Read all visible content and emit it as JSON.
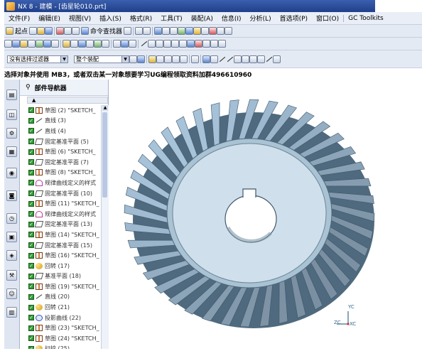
{
  "title_bar": {
    "text": "NX 8 - 建模 - [齿星轮010.prt]"
  },
  "menu": [
    {
      "label": "文件(F)"
    },
    {
      "label": "编辑(E)"
    },
    {
      "label": "视图(V)"
    },
    {
      "label": "插入(S)"
    },
    {
      "label": "格式(R)"
    },
    {
      "label": "工具(T)"
    },
    {
      "label": "装配(A)"
    },
    {
      "label": "信息(I)"
    },
    {
      "label": "分析(L)"
    },
    {
      "label": "首选项(P)"
    },
    {
      "label": "窗口(O)"
    },
    {
      "label": "GC Toolkits"
    }
  ],
  "toolbar1": {
    "start_label": "起点",
    "command_finder_label": "命令查找器"
  },
  "toolbar3": {
    "filter_value": "没有选择过滤器",
    "scope_value": "整个装配"
  },
  "status": {
    "text": "选择对象并使用 MB3，或者双击某一对象想要学习UG编程领取资料加群496610960"
  },
  "navigator": {
    "title": "部件导航器",
    "items": [
      {
        "icon": "sketch",
        "label": "草图 (2) \"SKETCH_"
      },
      {
        "icon": "line",
        "label": "直线 (3)"
      },
      {
        "icon": "line",
        "label": "直线 (4)"
      },
      {
        "icon": "plane",
        "label": "固定基准平面 (5)"
      },
      {
        "icon": "sketch",
        "label": "草图 (6) \"SKETCH_"
      },
      {
        "icon": "plane",
        "label": "固定基准平面 (7)"
      },
      {
        "icon": "sketch",
        "label": "草图 (8) \"SKETCH_"
      },
      {
        "icon": "curve",
        "label": "规律曲线定义的样式"
      },
      {
        "icon": "plane",
        "label": "固定基准平面 (10)"
      },
      {
        "icon": "sketch",
        "label": "草图 (11) \"SKETCH_"
      },
      {
        "icon": "curve",
        "label": "规律曲线定义的样式"
      },
      {
        "icon": "plane",
        "label": "固定基准平面 (13)"
      },
      {
        "icon": "sketch",
        "label": "草图 (14) \"SKETCH_"
      },
      {
        "icon": "plane",
        "label": "固定基准平面 (15)"
      },
      {
        "icon": "sketch",
        "label": "草图 (16) \"SKETCH_"
      },
      {
        "icon": "rev",
        "label": "回转 (17)"
      },
      {
        "icon": "plane",
        "label": "基准平面 (18)"
      },
      {
        "icon": "sketch",
        "label": "草图 (19) \"SKETCH_"
      },
      {
        "icon": "line",
        "label": "直线 (20)"
      },
      {
        "icon": "rev",
        "label": "回转 (21)"
      },
      {
        "icon": "proj",
        "label": "投影曲线 (22)"
      },
      {
        "icon": "sketch",
        "label": "草图 (23) \"SKETCH_"
      },
      {
        "icon": "sketch",
        "label": "草图 (24) \"SKETCH_"
      },
      {
        "icon": "rev",
        "label": "扫掠 (25)"
      }
    ]
  },
  "triad": {
    "y_label": "YC",
    "z_label": "ZC",
    "x_label": "XC"
  },
  "colors": {
    "titlebar": "#20408a",
    "gear_face": "#cfe0ec",
    "gear_tooth": "#6f8ea5",
    "check": "#2f9a33"
  }
}
